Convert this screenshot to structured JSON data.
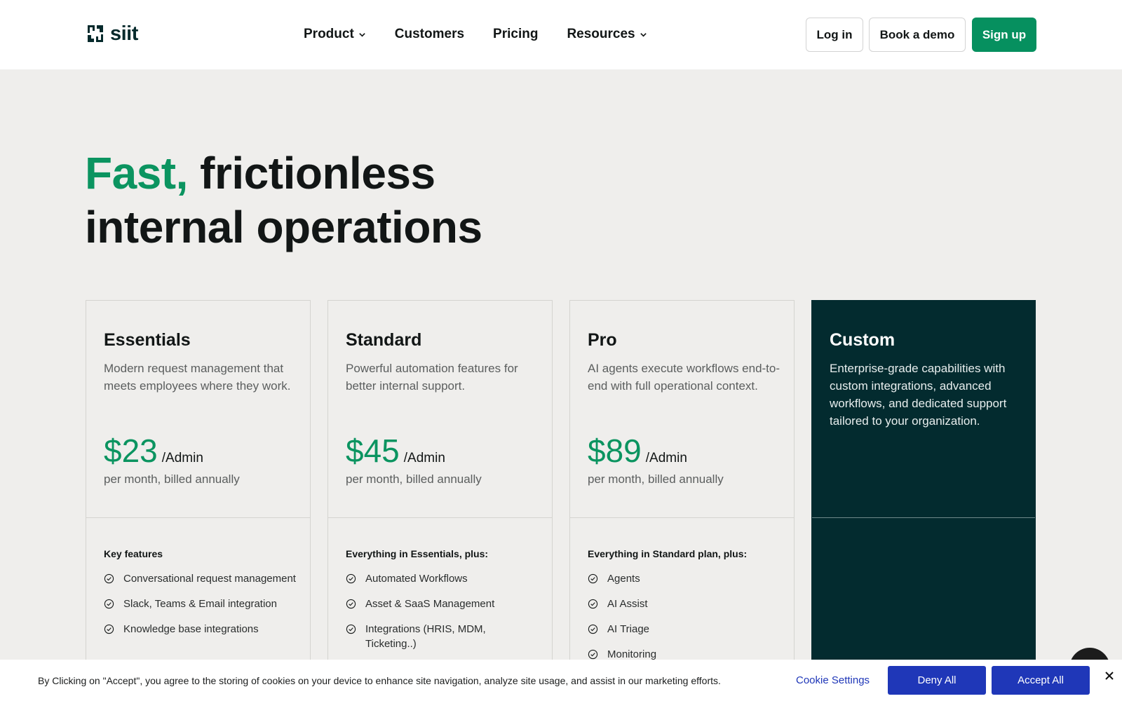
{
  "brand": {
    "logo_text": "siit",
    "colors": {
      "accent": "#0b9460",
      "signup": "#06905f",
      "dark": "#032b2f",
      "cookie_buttons": "#1f37b8"
    }
  },
  "nav": {
    "items": [
      {
        "label": "Product",
        "has_dropdown": true
      },
      {
        "label": "Customers",
        "has_dropdown": false
      },
      {
        "label": "Pricing",
        "has_dropdown": false
      },
      {
        "label": "Resources",
        "has_dropdown": true
      }
    ]
  },
  "header_actions": {
    "login": "Log in",
    "demo": "Book a demo",
    "signup": "Sign up"
  },
  "hero": {
    "accent": "Fast,",
    "line1_rest": " frictionless",
    "line2": "internal operations"
  },
  "plans": [
    {
      "name": "Essentials",
      "description": "Modern request management that meets employees where they work.",
      "price": "$23",
      "unit": "/Admin",
      "billing": "per month, billed annually",
      "features_heading": "Key features",
      "features": [
        "Conversational request management",
        "Slack, Teams & Email integration",
        "Knowledge base integrations"
      ]
    },
    {
      "name": "Standard",
      "description": "Powerful automation features for better internal support.",
      "price": "$45",
      "unit": "/Admin",
      "billing": "per month, billed annually",
      "features_heading": "Everything in Essentials, plus:",
      "features": [
        "Automated Workflows",
        "Asset & SaaS Management",
        "Integrations (HRIS, MDM, Ticketing..)"
      ]
    },
    {
      "name": "Pro",
      "description": "AI agents execute workflows end-to-end with full operational context.",
      "price": "$89",
      "unit": "/Admin",
      "billing": "per month, billed annually",
      "features_heading": "Everything in Standard plan, plus:",
      "features": [
        "Agents",
        "AI Assist",
        "AI Triage",
        "Monitoring"
      ]
    },
    {
      "name": "Custom",
      "description": "Enterprise-grade capabilities with custom integrations, advanced workflows, and dedicated support tailored to your organization."
    }
  ],
  "cookie": {
    "text": "By Clicking on \"Accept\", you agree to the storing of cookies on your device to enhance site navigation, analyze site usage, and assist in our marketing efforts.",
    "settings": "Cookie Settings",
    "deny": "Deny All",
    "accept": "Accept All"
  },
  "icons": {
    "logo": "siit-logo-mark",
    "nav_dropdown": "chevron-down-icon",
    "feature": "check-circle-icon",
    "cookie_close": "close-icon",
    "chat": "chat-icon"
  }
}
